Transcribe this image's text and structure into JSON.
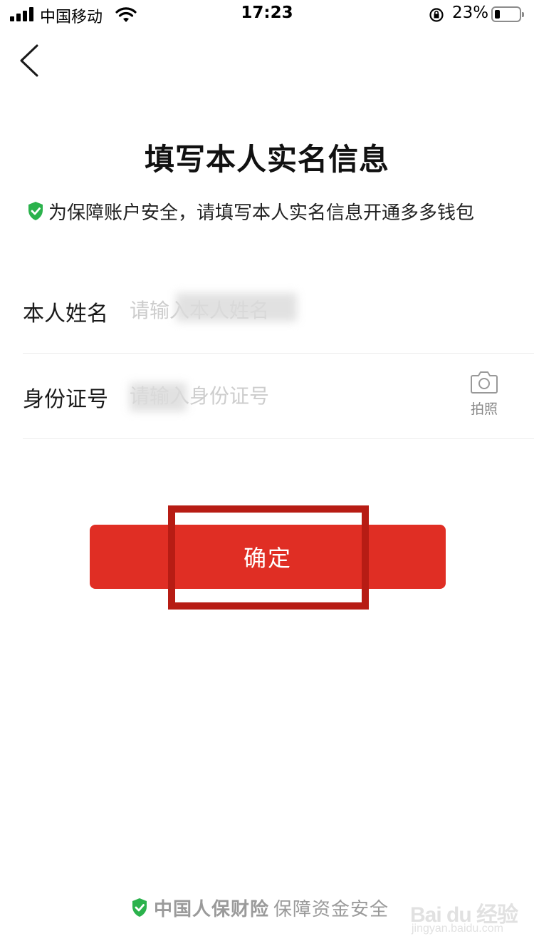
{
  "status_bar": {
    "carrier": "中国移动",
    "time": "17:23",
    "battery_percent": "23%",
    "battery_level": 0.23
  },
  "header": {
    "back_icon": "chevron-left-icon"
  },
  "page": {
    "title": "填写本人实名信息",
    "notice": "为保障账户安全，请填写本人实名信息开通多多钱包",
    "notice_icon": "shield-check-icon"
  },
  "form": {
    "name_label": "本人姓名",
    "name_placeholder": "请输入本人姓名",
    "id_label": "身份证号",
    "id_placeholder": "请输入身份证号",
    "camera_label": "拍照",
    "camera_icon": "camera-icon"
  },
  "confirm": {
    "label": "确定"
  },
  "footer": {
    "brand": "中国人保财险",
    "text": "保障资金安全"
  },
  "watermark": {
    "logo": "Bai du 经验",
    "sub": "jingyan.baidu.com"
  },
  "colors": {
    "accent_red": "#e02e24",
    "highlight_red": "#b71c14",
    "shield_green": "#2bb24c"
  }
}
